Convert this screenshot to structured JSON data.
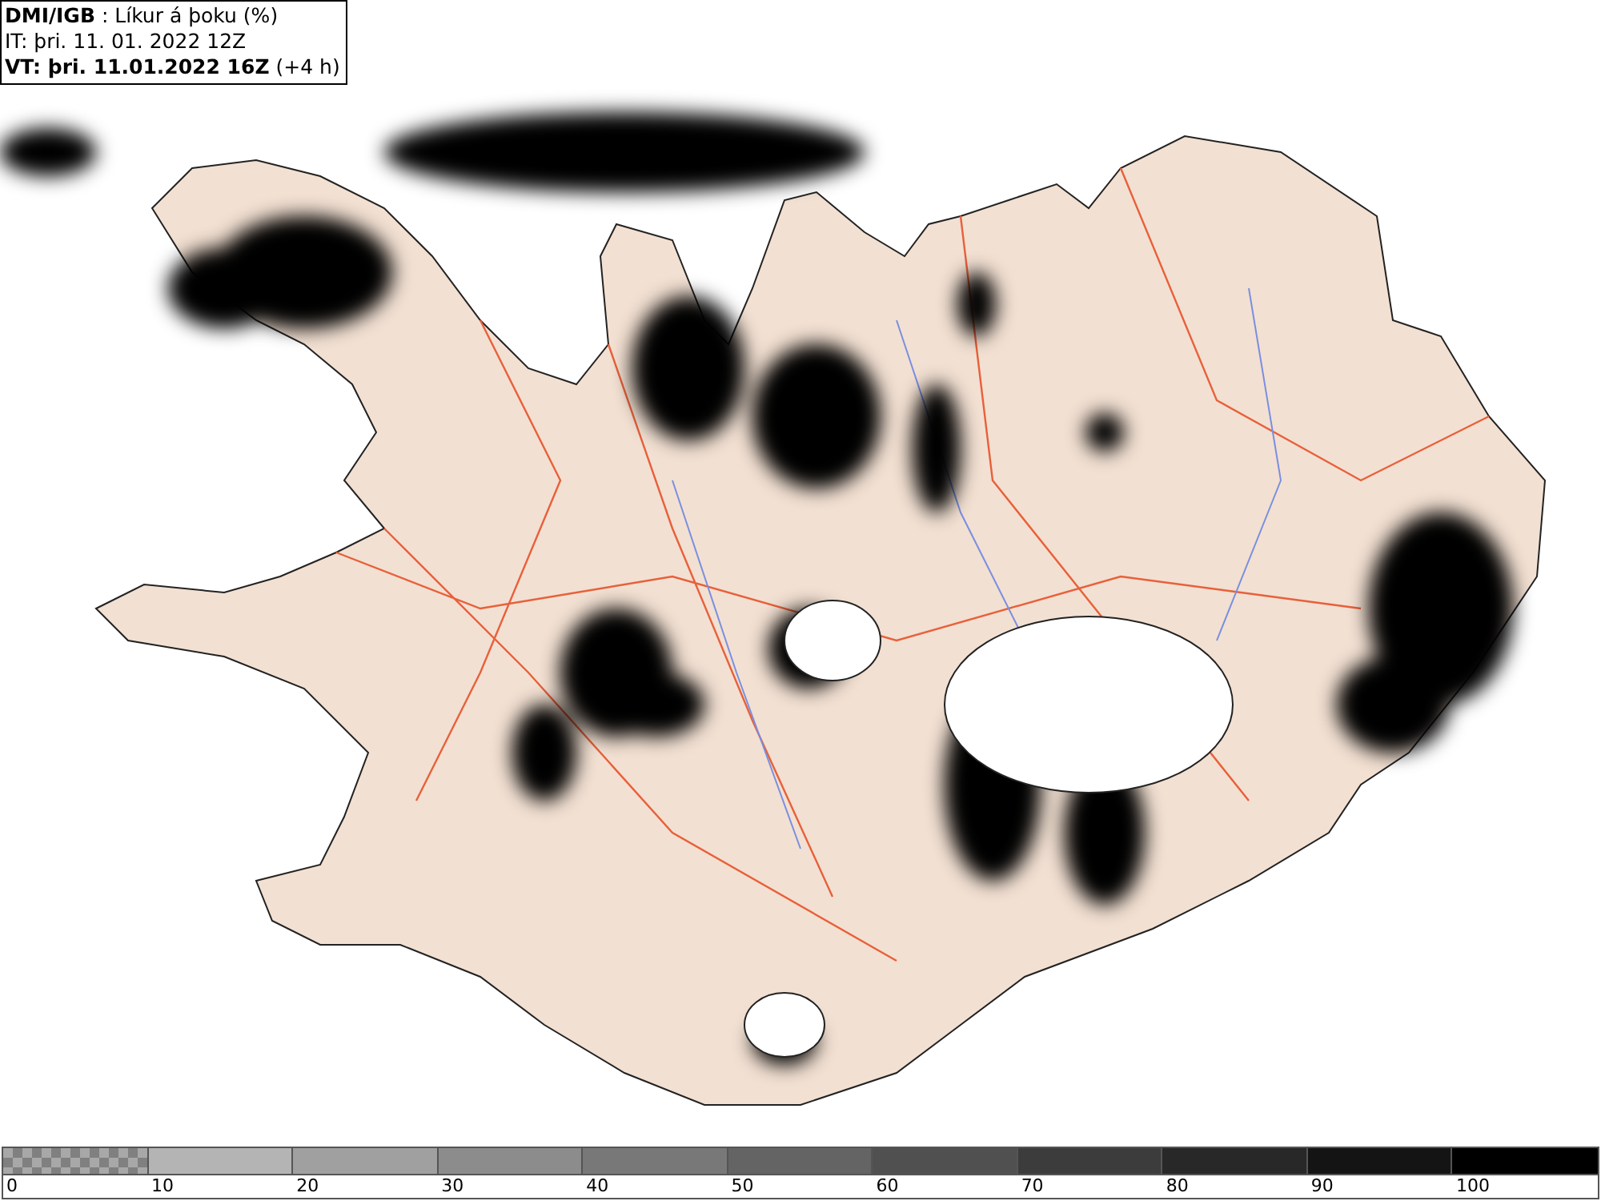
{
  "header": {
    "lines": [
      "**DMI/IGB** : Líkur á þoku (%)",
      "IT: þri. 11. 01. 2022 12Z",
      "**VT: þri. 11.01.2022 16Z** (+4 h)"
    ]
  },
  "legend": {
    "segments": [
      {
        "kind": "checker",
        "color": "#808080"
      },
      {
        "kind": "solid",
        "color": "#b4b4b4"
      },
      {
        "kind": "solid",
        "color": "#a0a0a0"
      },
      {
        "kind": "solid",
        "color": "#8c8c8c"
      },
      {
        "kind": "solid",
        "color": "#787878"
      },
      {
        "kind": "solid",
        "color": "#646464"
      },
      {
        "kind": "solid",
        "color": "#505050"
      },
      {
        "kind": "solid",
        "color": "#3c3c3c"
      },
      {
        "kind": "solid",
        "color": "#282828"
      },
      {
        "kind": "solid",
        "color": "#141414"
      },
      {
        "kind": "solid",
        "color": "#000000"
      }
    ],
    "labels": [
      "0",
      "10",
      "20",
      "30",
      "40",
      "50",
      "60",
      "70",
      "80",
      "90",
      "100"
    ]
  }
}
